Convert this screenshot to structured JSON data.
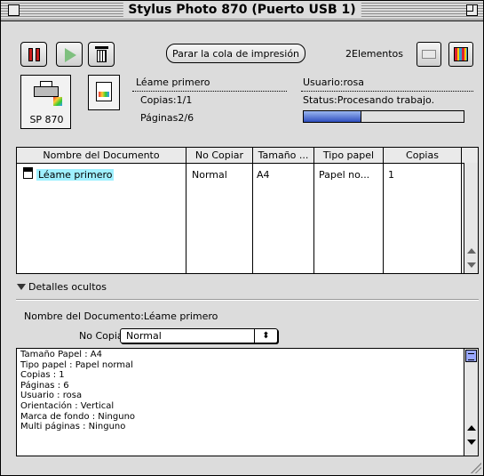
{
  "window": {
    "title": "Stylus Photo 870 (Puerto USB 1)"
  },
  "toolbar": {
    "cancel_queue_label": "Parar la cola de impresión",
    "element_count": "2Elementos"
  },
  "info": {
    "printer_name": "SP 870",
    "document_name": "Léame primero",
    "copies": "Copias:1/1",
    "pages": "Páginas2/6",
    "user": "Usuario:rosa",
    "status": "Status:Procesando trabajo.",
    "progress_percent": 36
  },
  "table": {
    "headers": [
      "Nombre del Documento",
      "No Copiar",
      "Tamaño ...",
      "Tipo papel",
      "Copias"
    ],
    "rows": [
      {
        "name": "Léame primero",
        "no_copy": "Normal",
        "size": "A4",
        "paper": "Papel no...",
        "copies": "1"
      }
    ]
  },
  "details": {
    "toggle_label": "Detalles ocultos",
    "doc_name_line": "Nombre del Documento:Léame primero",
    "no_copy_label": "No Copiar:",
    "no_copy_value": "Normal",
    "properties": [
      "Tamaño Papel : A4",
      "Tipo papel : Papel normal",
      "Copias : 1",
      "Páginas : 6",
      "Usuario : rosa",
      "Orientación : Vertical",
      "Marca de fondo : Ninguno",
      "Multi páginas : Ninguno"
    ]
  },
  "icons": [
    "close-box-icon",
    "zoom-box-icon",
    "pause-icon",
    "play-icon",
    "trash-icon",
    "printer-gray-icon",
    "ink-icon",
    "printer-icon",
    "document-icon",
    "disclosure-triangle-icon",
    "resize-grip-icon"
  ],
  "colors": {
    "selection": "#9ff0ff",
    "progress": "#3050c0",
    "pause": "#c81c1c",
    "play": "#7fc07f"
  }
}
